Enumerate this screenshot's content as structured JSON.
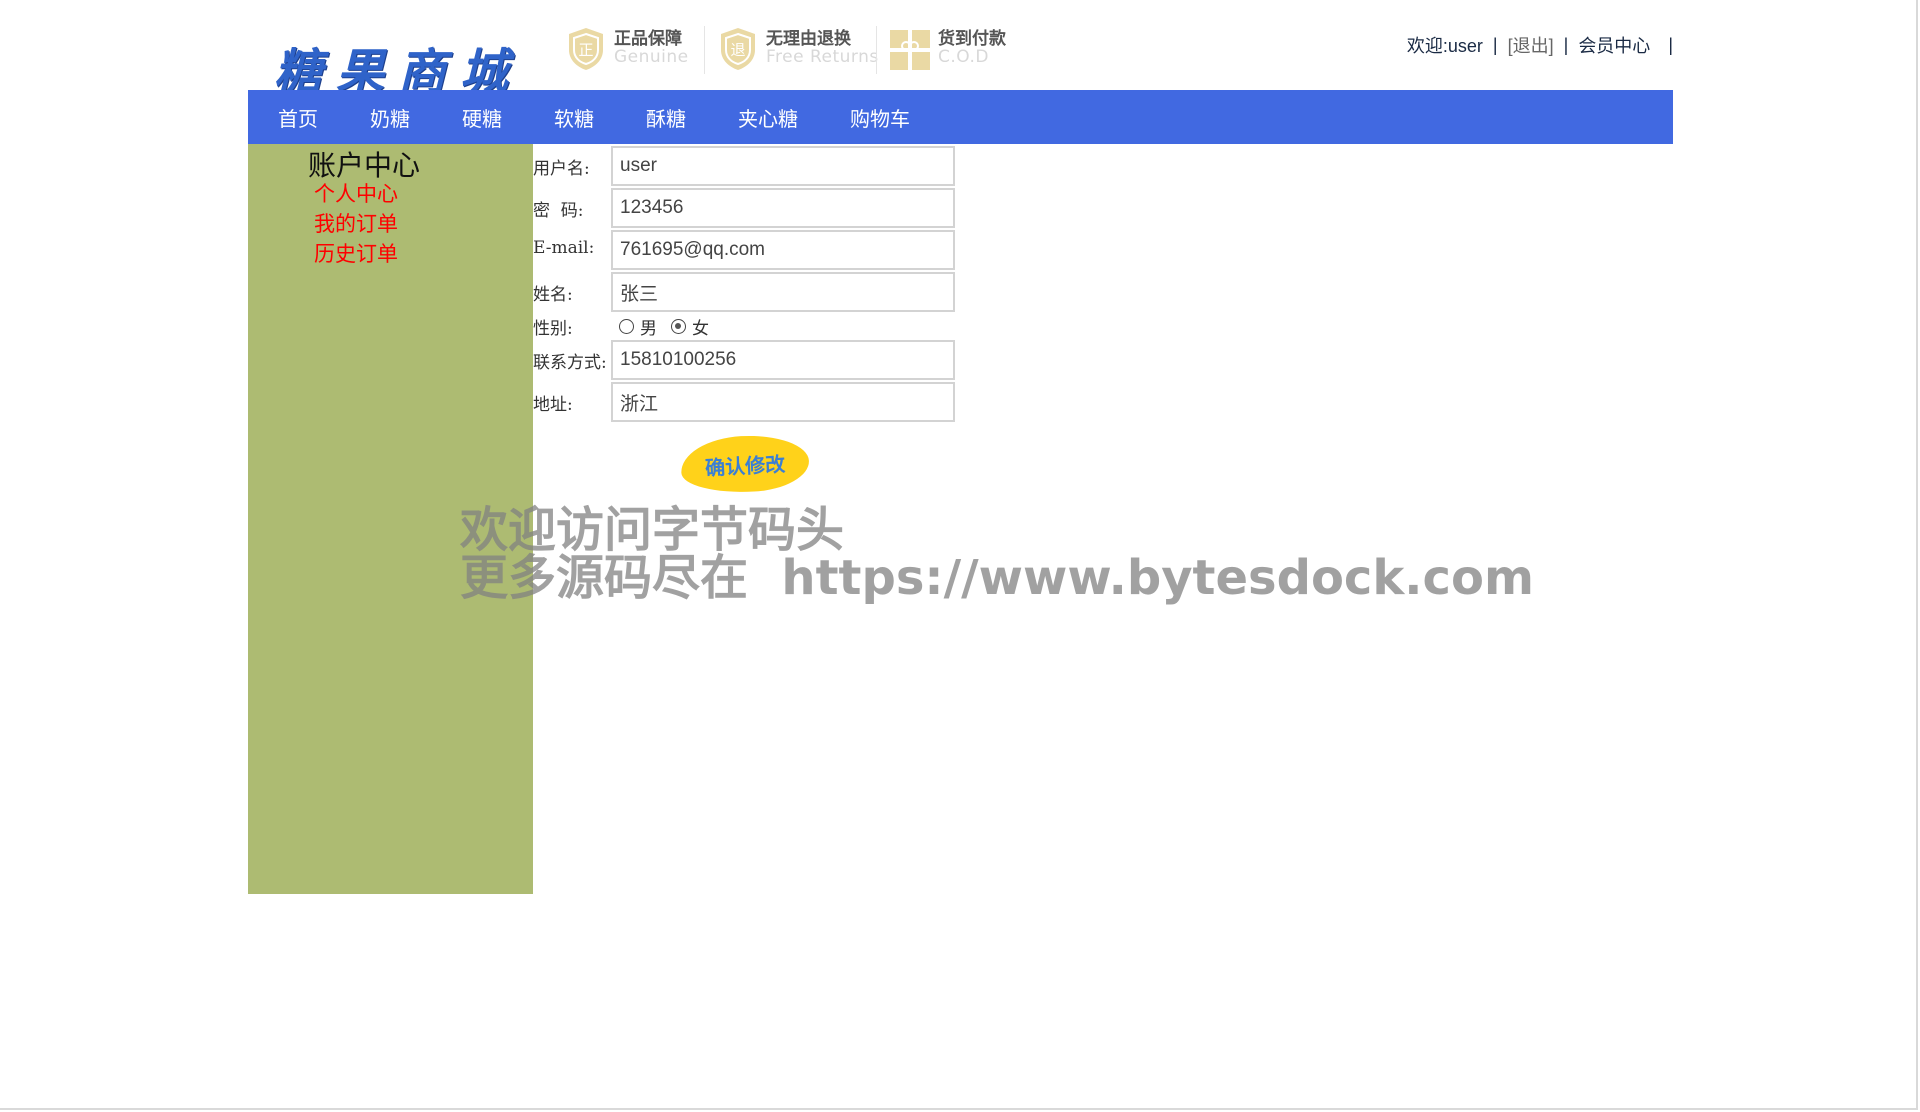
{
  "header": {
    "logo": "糖果商城",
    "promises": [
      {
        "icon": "genuine-shield-icon",
        "cn": "正品保障",
        "en": "Genuine"
      },
      {
        "icon": "returns-shield-icon",
        "cn": "无理由退换",
        "en": "Free Returns"
      },
      {
        "icon": "gift-box-icon",
        "cn": "货到付款",
        "en": "C.O.D"
      }
    ],
    "welcome": "欢迎:user",
    "logout": "[退出]",
    "member_center": "会员中心",
    "separator": "|"
  },
  "nav": {
    "items": [
      "首页",
      "奶糖",
      "硬糖",
      "软糖",
      "酥糖",
      "夹心糖",
      "购物车"
    ]
  },
  "sidebar": {
    "title": "账户中心",
    "links": [
      "个人中心",
      "我的订单",
      "历史订单"
    ]
  },
  "form": {
    "username_label": "用户名:",
    "username_value": "user",
    "password_label": "密  码:",
    "password_value": "123456",
    "email_label": "E-mail:",
    "email_value": "761695@qq.com",
    "name_label": "姓名:",
    "name_value": "张三",
    "gender_label": "性别:",
    "gender_options": [
      "男",
      "女"
    ],
    "gender_selected": "女",
    "phone_label": "联系方式:",
    "phone_value": "15810100256",
    "address_label": "地址:",
    "address_value": "浙江",
    "submit_label": "确认修改"
  },
  "watermark": {
    "line1": "欢迎访问字节码头",
    "line2": "更多源码尽在  https://www.bytesdock.com"
  },
  "colors": {
    "nav_bg": "#4169e1",
    "sidebar_bg": "#adbb72",
    "sidebar_link": "#ff0000",
    "button_bg": "#ffd21a",
    "button_text": "#3b7fd4",
    "logo": "#2f63c9"
  }
}
